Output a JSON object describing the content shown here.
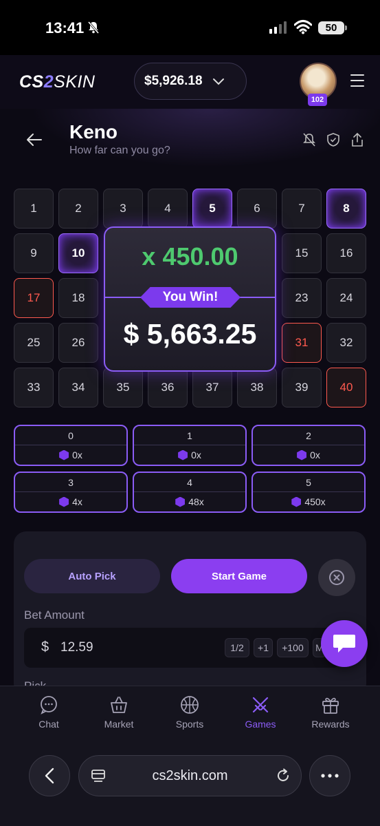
{
  "status_bar": {
    "time": "13:41",
    "battery": "50"
  },
  "header": {
    "logo_cs": "CS",
    "logo_two": "2",
    "logo_skin": "SKIN",
    "balance": "$5,926.18",
    "level": "102"
  },
  "page": {
    "title": "Keno",
    "subtitle": "How far can you go?"
  },
  "grid": {
    "tiles": [
      "1",
      "2",
      "3",
      "4",
      "5",
      "6",
      "7",
      "8",
      "9",
      "10",
      "",
      "",
      "",
      "",
      "15",
      "16",
      "17",
      "18",
      "",
      "",
      "",
      "",
      "23",
      "24",
      "25",
      "26",
      "",
      "",
      "",
      "",
      "31",
      "32",
      "33",
      "34",
      "35",
      "36",
      "37",
      "38",
      "39",
      "40"
    ],
    "gem_tiles": [
      "5",
      "8",
      "10"
    ],
    "hit_tiles": [
      "17",
      "31",
      "40"
    ]
  },
  "win_popup": {
    "multiplier": "x 450.00",
    "badge": "You Win!",
    "amount": "$ 5,663.25"
  },
  "payouts": [
    {
      "hits": "0",
      "multiplier": "0x"
    },
    {
      "hits": "1",
      "multiplier": "0x"
    },
    {
      "hits": "2",
      "multiplier": "0x"
    },
    {
      "hits": "3",
      "multiplier": "4x"
    },
    {
      "hits": "4",
      "multiplier": "48x"
    },
    {
      "hits": "5",
      "multiplier": "450x"
    }
  ],
  "controls": {
    "auto_pick": "Auto Pick",
    "start_game": "Start Game",
    "bet_label": "Bet Amount",
    "currency": "$",
    "bet_value": "12.59",
    "chip_half": "1/2",
    "chip_plus1": "+1",
    "chip_plus100": "+100",
    "chip_max": "M",
    "pick_label": "Pick"
  },
  "nav": {
    "chat": "Chat",
    "market": "Market",
    "sports": "Sports",
    "games": "Games",
    "rewards": "Rewards"
  },
  "browser": {
    "url": "cs2skin.com"
  },
  "colors": {
    "accent": "#8b5cf6",
    "win_green": "#4ec96f",
    "hit_red": "#ff5a4f"
  }
}
